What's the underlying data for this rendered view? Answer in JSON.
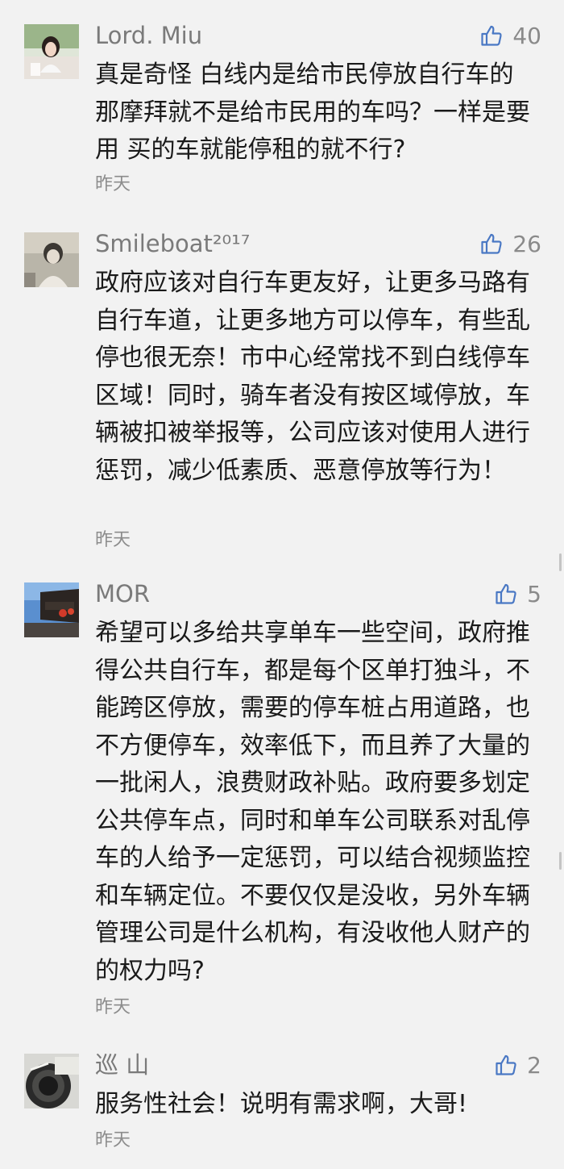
{
  "comments": [
    {
      "user": "Lord. Miu",
      "likes": "40",
      "text": "真是奇怪 白线内是给市民停放自行车的 那摩拜就不是给市民用的车吗？一样是要用 买的车就能停租的就不行?",
      "time": "昨天",
      "avatar_icon": "girl-portrait-avatar"
    },
    {
      "user": "Smileboat²⁰¹⁷",
      "likes": "26",
      "text": "政府应该对自行车更友好，让更多马路有自行车道，让更多地方可以停车，有些乱停也很无奈！市中心经常找不到白线停车区域！同时，骑车者没有按区域停放，车辆被扣被举报等，公司应该对使用人进行惩罚，减少低素质、恶意停放等行为！",
      "time": "昨天",
      "avatar_icon": "child-photo-avatar"
    },
    {
      "user": "MOR",
      "likes": "5",
      "text": "希望可以多给共享单车一些空间，政府推得公共自行车，都是每个区单打独斗，不能跨区停放，需要的停车桩占用道路，也不方便停车，效率低下，而且养了大量的一批闲人，浪费财政补贴。政府要多划定公共停车点，同时和单车公司联系对乱停车的人给予一定惩罚，可以结合视频监控和车辆定位。不要仅仅是没收，另外车辆管理公司是什么机构，有没收他人财产的的权力吗?",
      "time": "昨天",
      "avatar_icon": "street-lantern-avatar"
    },
    {
      "user": "巡 山",
      "likes": "2",
      "text": "服务性社会！说明有需求啊，大哥!",
      "time": "昨天",
      "avatar_icon": "camera-lens-avatar"
    }
  ],
  "icons": {
    "like": "thumbs-up-icon"
  },
  "colors": {
    "background": "#f2f2f2",
    "accent": "#4a78c4",
    "muted": "#8c8c8c"
  }
}
